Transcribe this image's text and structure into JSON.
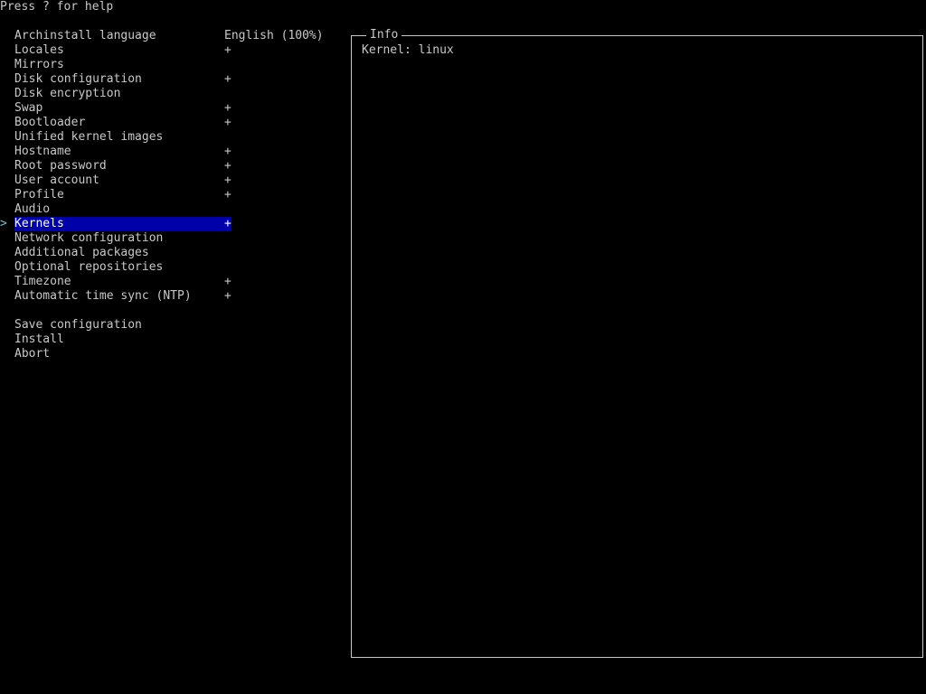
{
  "header": {
    "help": "Press ? for help"
  },
  "menu": {
    "cursor_glyph": ">",
    "items": [
      {
        "label": "Archinstall language",
        "mark": "English (100%)"
      },
      {
        "label": "Locales",
        "mark": "+"
      },
      {
        "label": "Mirrors",
        "mark": ""
      },
      {
        "label": "Disk configuration",
        "mark": "+"
      },
      {
        "label": "Disk encryption",
        "mark": ""
      },
      {
        "label": "Swap",
        "mark": "+"
      },
      {
        "label": "Bootloader",
        "mark": "+"
      },
      {
        "label": "Unified kernel images",
        "mark": ""
      },
      {
        "label": "Hostname",
        "mark": "+"
      },
      {
        "label": "Root password",
        "mark": "+"
      },
      {
        "label": "User account",
        "mark": "+"
      },
      {
        "label": "Profile",
        "mark": "+"
      },
      {
        "label": "Audio",
        "mark": ""
      },
      {
        "label": "Kernels",
        "mark": "+"
      },
      {
        "label": "Network configuration",
        "mark": ""
      },
      {
        "label": "Additional packages",
        "mark": ""
      },
      {
        "label": "Optional repositories",
        "mark": ""
      },
      {
        "label": "Timezone",
        "mark": "+"
      },
      {
        "label": "Automatic time sync (NTP)",
        "mark": "+"
      }
    ],
    "actions": [
      {
        "label": "Save configuration"
      },
      {
        "label": "Install"
      },
      {
        "label": "Abort"
      }
    ]
  },
  "info_panel": {
    "title": "Info",
    "text": "Kernel: linux"
  },
  "colors": {
    "background": "#000000",
    "text": "#c8c8c8",
    "highlight": "#0000aa",
    "cursor": "#6ec6d8"
  }
}
